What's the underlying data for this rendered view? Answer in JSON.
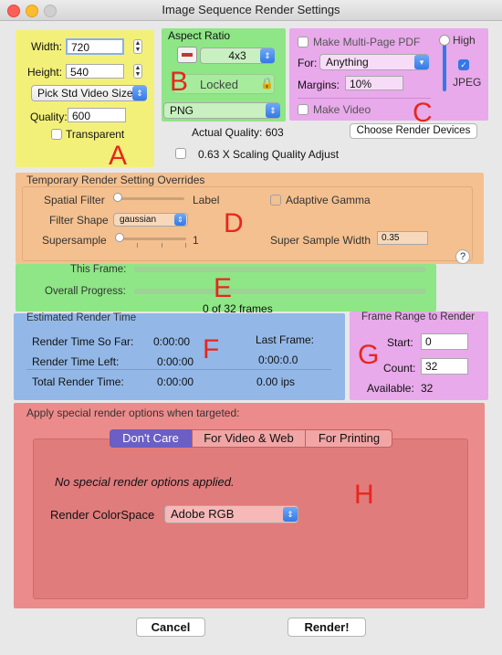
{
  "window": {
    "title": "Image Sequence Render Settings"
  },
  "colors": {
    "yellow": "#f3f07a",
    "green": "#8ee686",
    "magenta": "#e8aaea",
    "orange": "#f4c08f",
    "blue": "#93b8e8",
    "red": "#ec8b8b",
    "letter": "#e8261c"
  },
  "sectionA": {
    "width_label": "Width:",
    "width_value": "720",
    "height_label": "Height:",
    "height_value": "540",
    "size_popup": "Pick Std Video Size",
    "quality_label": "Quality:",
    "quality_value": "600",
    "transparent_label": "Transparent",
    "letter": "A"
  },
  "sectionB": {
    "title": "Aspect Ratio",
    "ratio_value": "4x3",
    "locked_label": "Locked",
    "format_value": "PNG",
    "letter": "B"
  },
  "sectionC": {
    "multipage_label": "Make Multi-Page PDF",
    "for_label": "For:",
    "for_value": "Anything",
    "margins_label": "Margins:",
    "margins_value": "10%",
    "make_video_label": "Make Video",
    "high_label": "High",
    "jpeg_label": "JPEG",
    "letter": "C"
  },
  "choose_devices_button": "Choose Render Devices",
  "actual_quality": "Actual Quality: 603",
  "scaling_label": "0.63 X Scaling Quality Adjust",
  "sectionD": {
    "title": "Temporary Render  Setting Overrides",
    "spatial_filter_label": "Spatial Filter",
    "label_text": "Label",
    "adaptive_gamma_label": "Adaptive Gamma",
    "filter_shape_label": "Filter Shape",
    "filter_shape_value": "gaussian",
    "supersample_label": "Supersample",
    "supersample_value": "1",
    "super_sample_width_label": "Super Sample Width",
    "super_sample_width_value": "0.35",
    "help": "?",
    "letter": "D"
  },
  "sectionE": {
    "this_frame_label": "This Frame:",
    "overall_label": "Overall Progress:",
    "frames_text": "0 of 32 frames",
    "this_frame_progress": 0,
    "overall_progress": 0,
    "letter": "E"
  },
  "sectionF": {
    "title": "Estimated Render Time",
    "so_far_label": "Render Time So Far:",
    "so_far_value": "0:00:00",
    "left_label": "Render Time Left:",
    "left_value": "0:00:00",
    "total_label": "Total Render Time:",
    "total_value": "0:00:00",
    "last_frame_label": "Last Frame:",
    "last_frame_value": "0:00:0.0",
    "ips_value": "0.00 ips",
    "letter": "F"
  },
  "sectionG": {
    "title": "Frame Range to Render",
    "start_label": "Start:",
    "start_value": "0",
    "count_label": "Count:",
    "count_value": "32",
    "available_label": "Available:",
    "available_value": "32",
    "letter": "G"
  },
  "sectionH": {
    "title": "Apply special render options when targeted:",
    "tabs": [
      "Don't Care",
      "For Video & Web",
      "For Printing"
    ],
    "message": "No special render options applied.",
    "colorspace_label": "Render ColorSpace",
    "colorspace_value": "Adobe RGB",
    "letter": "H"
  },
  "footer": {
    "cancel": "Cancel",
    "render": "Render!"
  }
}
